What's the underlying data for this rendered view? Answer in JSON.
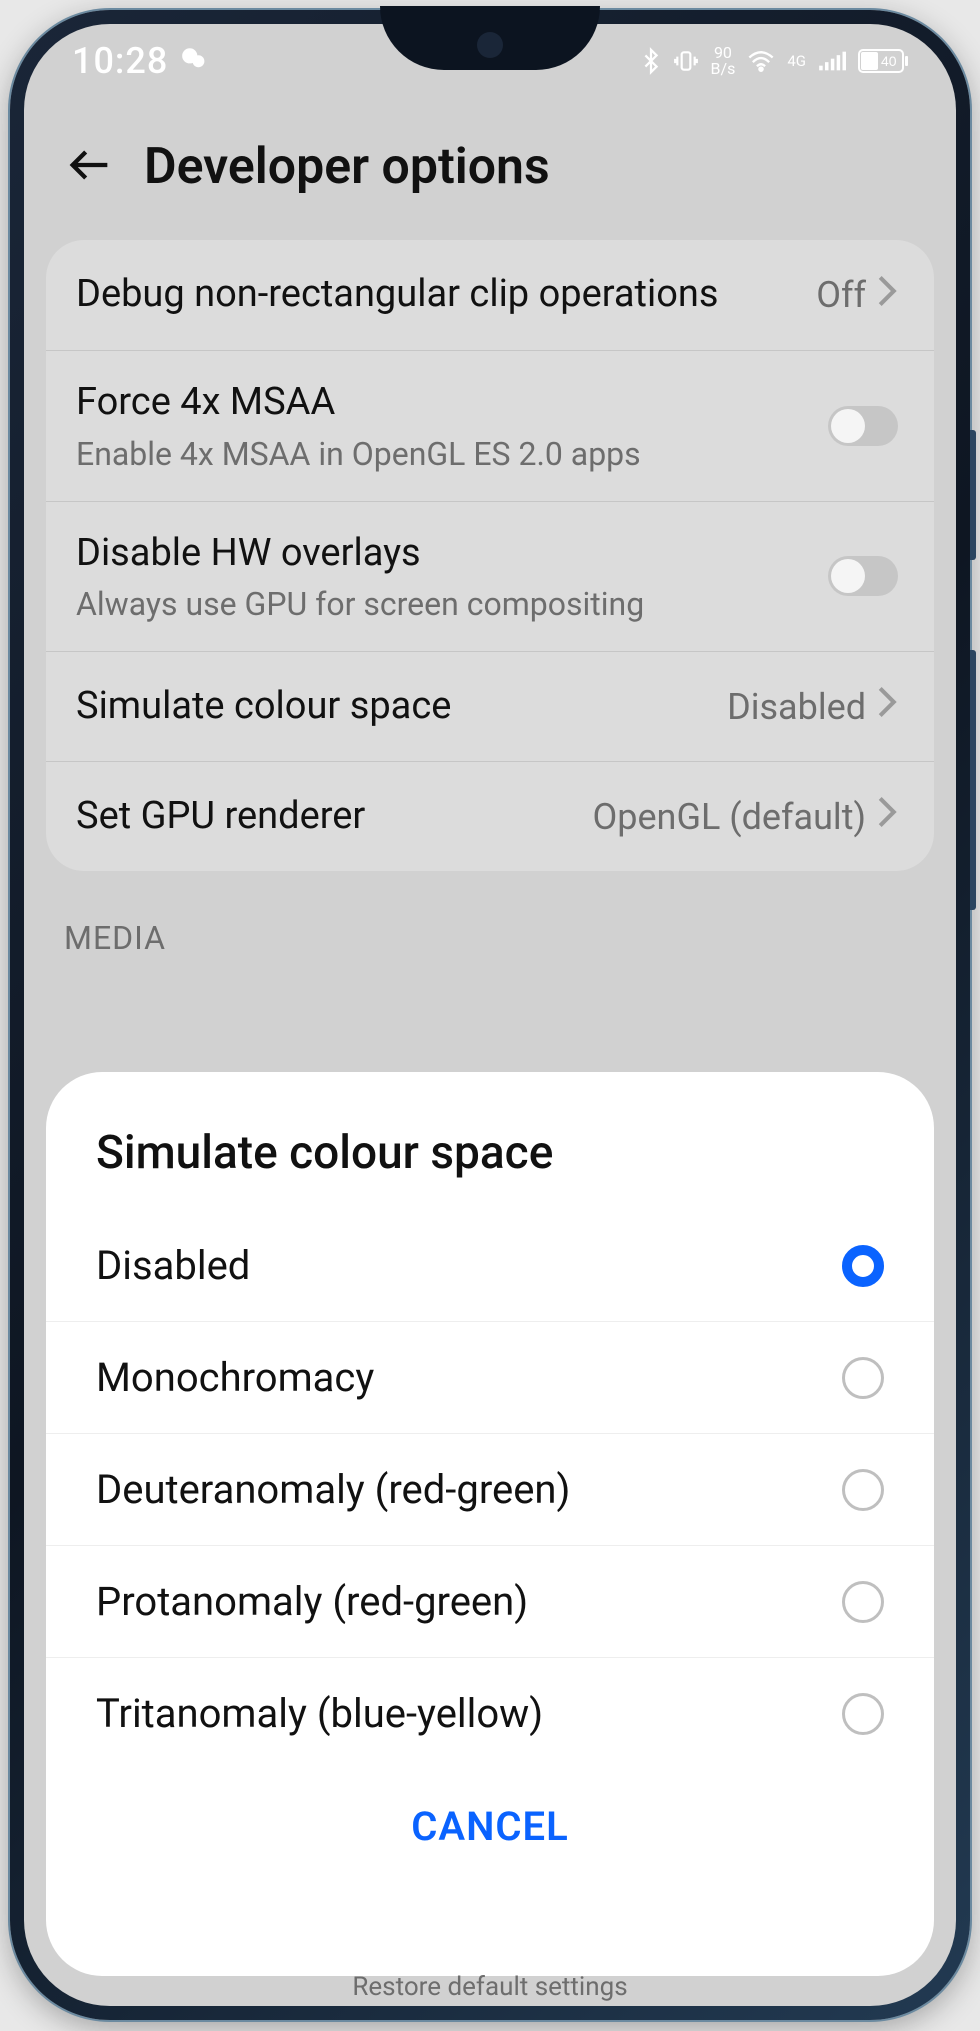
{
  "statusbar": {
    "time": "10:28",
    "dataRate": {
      "value": "90",
      "unit": "B/s"
    },
    "network": "4G",
    "battery": "40"
  },
  "header": {
    "title": "Developer options"
  },
  "settings": {
    "items": [
      {
        "title": "Debug non-rectangular clip operations",
        "sub": "",
        "value": "Off",
        "type": "value"
      },
      {
        "title": "Force 4x MSAA",
        "sub": "Enable 4x MSAA in OpenGL ES 2.0 apps",
        "value": "",
        "type": "toggle",
        "on": false
      },
      {
        "title": "Disable HW overlays",
        "sub": "Always use GPU for screen compositing",
        "value": "",
        "type": "toggle",
        "on": false
      },
      {
        "title": "Simulate colour space",
        "sub": "",
        "value": "Disabled",
        "type": "value"
      },
      {
        "title": "Set GPU renderer",
        "sub": "",
        "value": "OpenGL (default)",
        "type": "value"
      }
    ]
  },
  "sectionLabel": "MEDIA",
  "dialog": {
    "title": "Simulate colour space",
    "options": [
      {
        "label": "Disabled",
        "selected": true
      },
      {
        "label": "Monochromacy",
        "selected": false
      },
      {
        "label": "Deuteranomaly (red-green)",
        "selected": false
      },
      {
        "label": "Protanomaly (red-green)",
        "selected": false
      },
      {
        "label": "Tritanomaly (blue-yellow)",
        "selected": false
      }
    ],
    "cancel": "CANCEL"
  },
  "footerHint": "Restore default settings"
}
